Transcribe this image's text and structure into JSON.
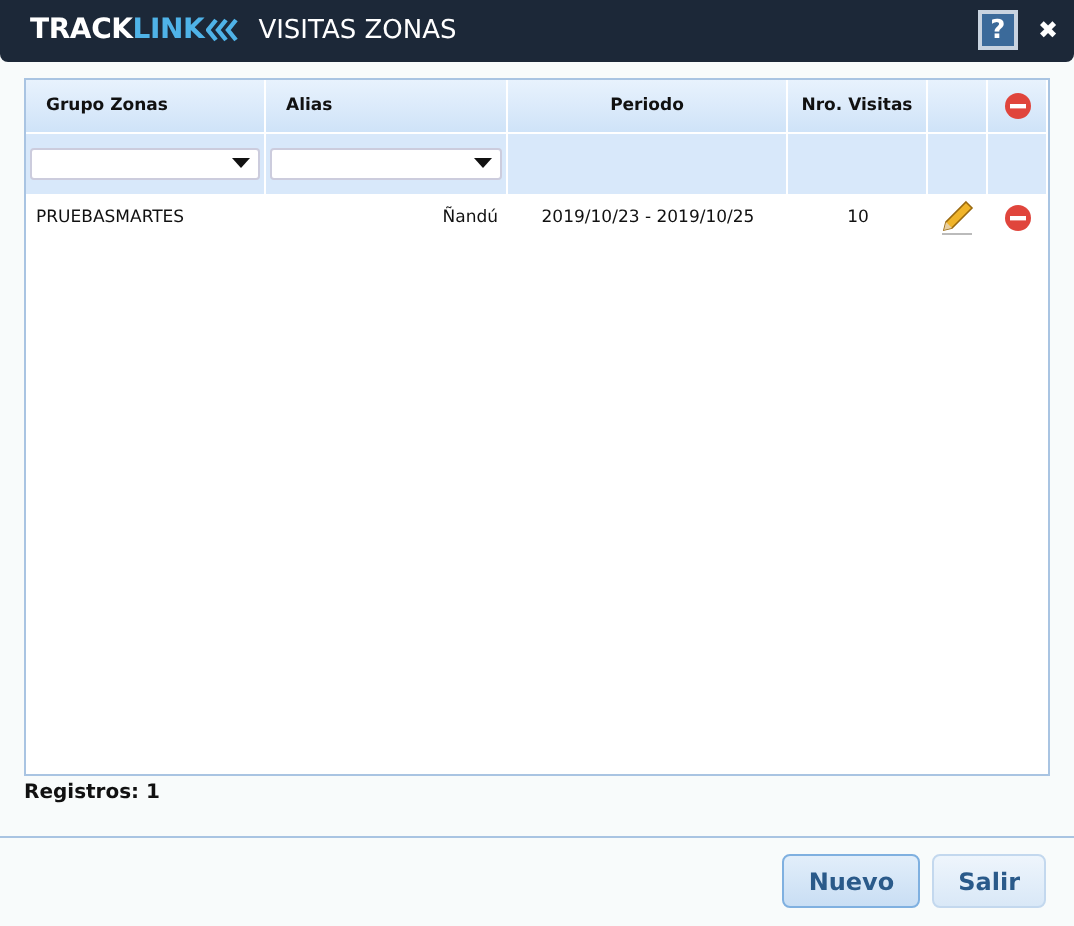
{
  "window": {
    "logo_left": "TRACK",
    "logo_right": "LINK",
    "title": "VISITAS ZONAS",
    "help": "?",
    "close": "✖"
  },
  "table": {
    "columns": [
      {
        "kind": "text",
        "label": "Grupo Zonas"
      },
      {
        "kind": "text",
        "label": "Alias"
      },
      {
        "kind": "text",
        "label": "Periodo"
      },
      {
        "kind": "text",
        "label": "Nro. Visitas"
      },
      {
        "kind": "blank"
      },
      {
        "kind": "delete-all"
      }
    ],
    "filters": [
      {
        "kind": "dropdown"
      },
      {
        "kind": "dropdown"
      },
      {
        "kind": "blank"
      },
      {
        "kind": "blank"
      },
      {
        "kind": "blank"
      },
      {
        "kind": "blank"
      }
    ],
    "rows": [
      {
        "grupo": "PRUEBASMARTES",
        "alias": "Ñandú",
        "periodo": "2019/10/23 - 2019/10/25",
        "visitas": "10"
      }
    ]
  },
  "footer": {
    "count": "Registros: 1"
  },
  "buttons": [
    {
      "label": "Nuevo",
      "default": true
    },
    {
      "label": "Salir",
      "default": false
    }
  ]
}
